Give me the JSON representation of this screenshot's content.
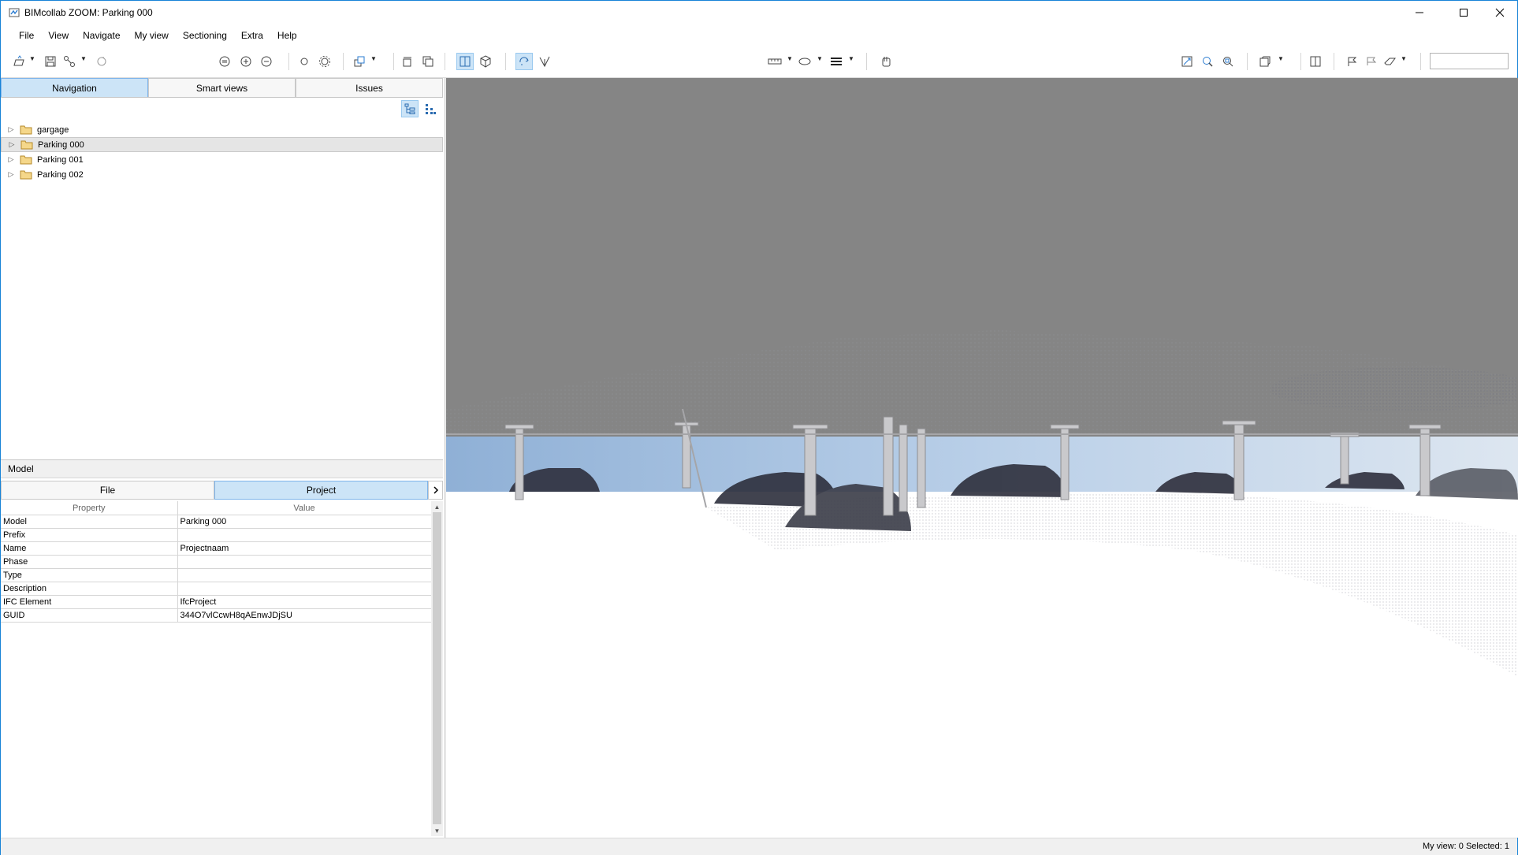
{
  "window": {
    "title": "BIMcollab ZOOM: Parking 000"
  },
  "menu": [
    "File",
    "View",
    "Navigate",
    "My view",
    "Sectioning",
    "Extra",
    "Help"
  ],
  "toolbar": {
    "search_value": ""
  },
  "left_panel": {
    "tabs": [
      "Navigation",
      "Smart views",
      "Issues"
    ],
    "tree": [
      "gargage",
      "Parking 000",
      "Parking 001",
      "Parking 002"
    ]
  },
  "model": {
    "header": "Model",
    "subtabs": [
      "File",
      "Project"
    ],
    "columns": [
      "Property",
      "Value"
    ],
    "rows": [
      {
        "property": "Model",
        "value": "Parking 000"
      },
      {
        "property": "Prefix",
        "value": ""
      },
      {
        "property": "Name",
        "value": "Projectnaam"
      },
      {
        "property": "Phase",
        "value": ""
      },
      {
        "property": "Type",
        "value": ""
      },
      {
        "property": "Description",
        "value": ""
      },
      {
        "property": "IFC Element",
        "value": "IfcProject"
      },
      {
        "property": "GUID",
        "value": "344O7vlCcwH8qAEnwJDjSU"
      }
    ]
  },
  "status": {
    "text": "My view: 0   Selected: 1"
  },
  "colors": {
    "accent": "#cce4f7",
    "window_border": "#1883d7",
    "sky": "#8a8a8a",
    "ceiling_band": "#a6c3e3"
  }
}
